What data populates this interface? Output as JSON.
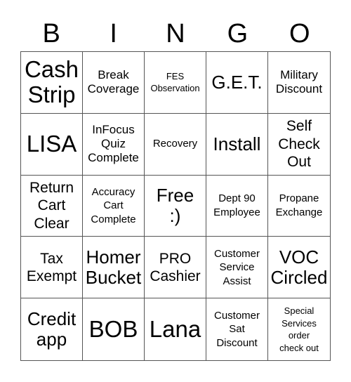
{
  "header": {
    "letters": [
      "B",
      "I",
      "N",
      "G",
      "O"
    ]
  },
  "board": {
    "cells": [
      {
        "text": "Cash\nStrip",
        "size": "s-xl"
      },
      {
        "text": "Break\nCoverage",
        "size": "s-sm"
      },
      {
        "text": "FES\nObservation",
        "size": "s-xxs"
      },
      {
        "text": "G.E.T.",
        "size": "s-lg"
      },
      {
        "text": "Military\nDiscount",
        "size": "s-sm"
      },
      {
        "text": "LISA",
        "size": "s-xl"
      },
      {
        "text": "InFocus\nQuiz\nComplete",
        "size": "s-sm"
      },
      {
        "text": "Recovery",
        "size": "s-xs"
      },
      {
        "text": "Install",
        "size": "s-lg"
      },
      {
        "text": "Self\nCheck\nOut",
        "size": "s-md"
      },
      {
        "text": "Return\nCart\nClear",
        "size": "s-md"
      },
      {
        "text": "Accuracy\nCart\nComplete",
        "size": "s-xs"
      },
      {
        "text": "Free\n:)",
        "size": "s-lg"
      },
      {
        "text": "Dept 90\nEmployee",
        "size": "s-xs"
      },
      {
        "text": "Propane\nExchange",
        "size": "s-xs"
      },
      {
        "text": "Tax\nExempt",
        "size": "s-md"
      },
      {
        "text": "Homer\nBucket",
        "size": "s-lg"
      },
      {
        "text": "PRO\nCashier",
        "size": "s-md"
      },
      {
        "text": "Customer\nService\nAssist",
        "size": "s-xs"
      },
      {
        "text": "VOC\nCircled",
        "size": "s-lg"
      },
      {
        "text": "Credit\napp",
        "size": "s-lg"
      },
      {
        "text": "BOB",
        "size": "s-xl"
      },
      {
        "text": "Lana",
        "size": "s-xl"
      },
      {
        "text": "Customer\nSat\nDiscount",
        "size": "s-xs"
      },
      {
        "text": "Special\nServices\norder\ncheck out",
        "size": "s-xxs"
      }
    ]
  }
}
